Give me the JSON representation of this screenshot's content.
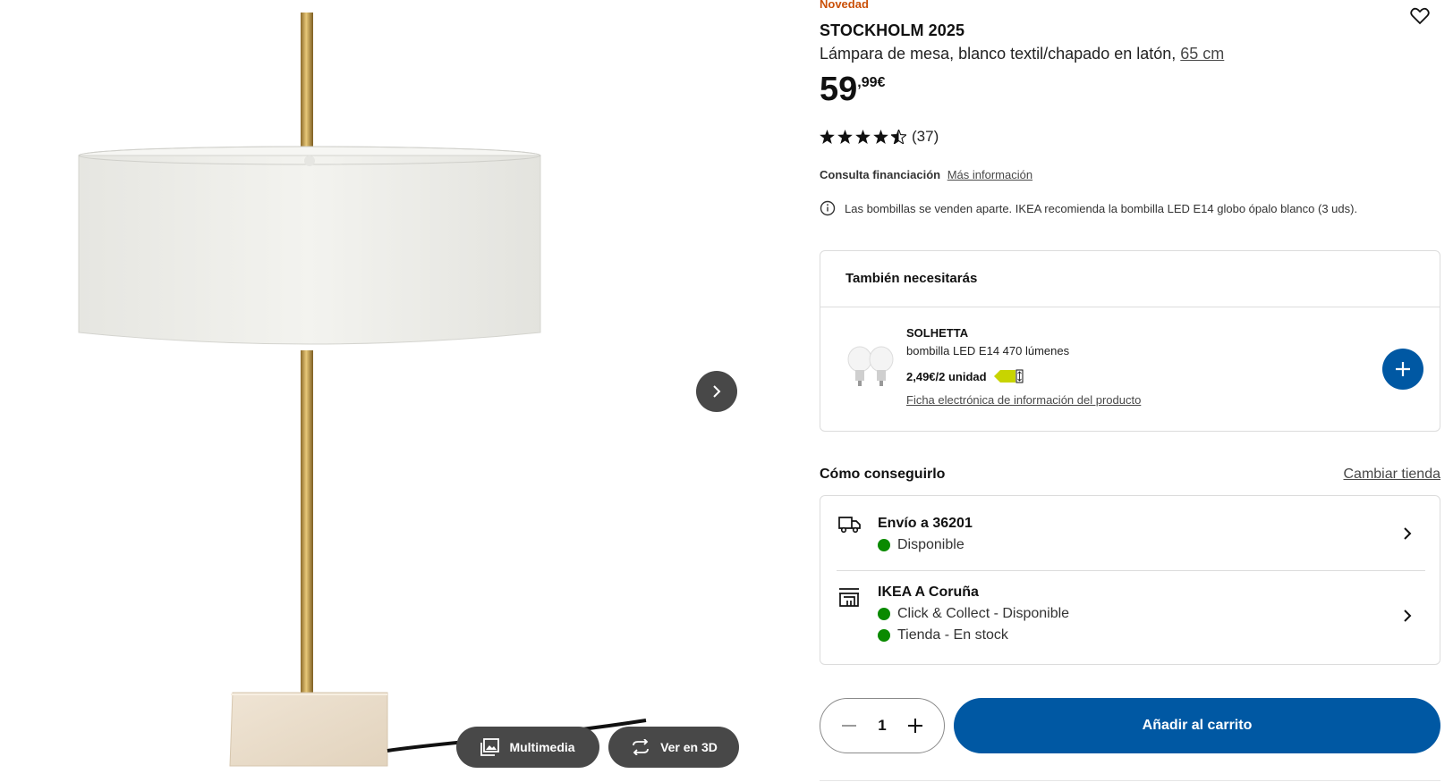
{
  "gallery": {
    "media_label": "Multimedia",
    "view3d_label": "Ver en 3D"
  },
  "product": {
    "badge": "Novedad",
    "name": "STOCKHOLM 2025",
    "description": "Lámpara de mesa, blanco textil/chapado en latón,",
    "size_link": "65 cm",
    "price_int": "59",
    "price_dec": ",99€",
    "rating_count": "(37)",
    "rating_value": 4.5,
    "rating_max": 5
  },
  "finance": {
    "label": "Consulta financiación",
    "link": "Más información"
  },
  "bulb_note": "Las bombillas se venden aparte. IKEA recomienda la bombilla LED E14 globo ópalo blanco (3 uds).",
  "need": {
    "title": "También necesitarás",
    "item_name": "SOLHETTA",
    "item_desc": "bombilla LED E14 470 lúmenes",
    "item_price": "2,49€/2 unidad",
    "energy_class": "C",
    "item_link": "Ficha electrónica de información del producto"
  },
  "availability": {
    "title": "Cómo conseguirlo",
    "change_store": "Cambiar tienda",
    "delivery_title": "Envío a 36201",
    "delivery_status": "Disponible",
    "store_title": "IKEA A Coruña",
    "store_status_1": "Click & Collect - Disponible",
    "store_status_2": "Tienda - En stock",
    "status_color": "#0a8a00"
  },
  "cart": {
    "quantity": "1",
    "add_label": "Añadir al carrito"
  },
  "colors": {
    "brand_blue": "#0058a3",
    "badge_orange": "#ca5008"
  }
}
